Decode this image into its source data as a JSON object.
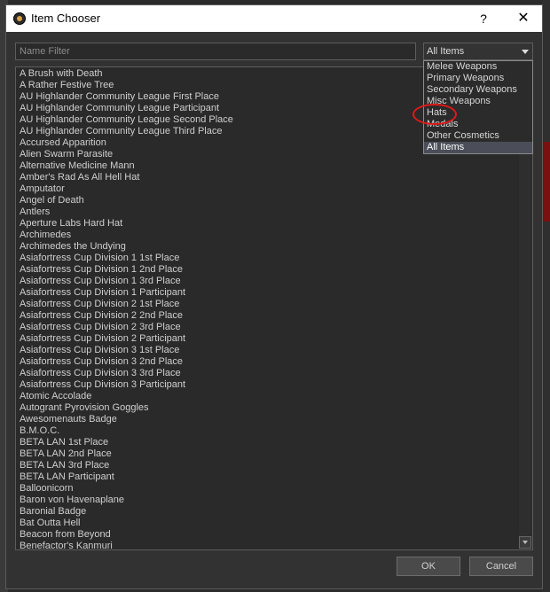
{
  "window": {
    "title": "Item Chooser",
    "help_label": "?",
    "close_label": "✕"
  },
  "filter": {
    "placeholder": "Name Filter",
    "value": ""
  },
  "category": {
    "selected": "All Items",
    "options": [
      "Melee Weapons",
      "Primary Weapons",
      "Secondary Weapons",
      "Misc Weapons",
      "Hats",
      "Medals",
      "Other Cosmetics",
      "All Items"
    ],
    "highlighted_option": "Hats",
    "highlight_color": "#e01919"
  },
  "items": [
    "A Brush with Death",
    "A Rather Festive Tree",
    "AU Highlander Community League First Place",
    "AU Highlander Community League Participant",
    "AU Highlander Community League Second Place",
    "AU Highlander Community League Third Place",
    "Accursed Apparition",
    "Alien Swarm Parasite",
    "Alternative Medicine Mann",
    "Amber's Rad As All Hell Hat",
    "Amputator",
    "Angel of Death",
    "Antlers",
    "Aperture Labs Hard Hat",
    "Archimedes",
    "Archimedes the Undying",
    "Asiafortress Cup Division 1 1st Place",
    "Asiafortress Cup Division 1 2nd Place",
    "Asiafortress Cup Division 1 3rd Place",
    "Asiafortress Cup Division 1 Participant",
    "Asiafortress Cup Division 2 1st Place",
    "Asiafortress Cup Division 2 2nd Place",
    "Asiafortress Cup Division 2 3rd Place",
    "Asiafortress Cup Division 2 Participant",
    "Asiafortress Cup Division 3 1st Place",
    "Asiafortress Cup Division 3 2nd Place",
    "Asiafortress Cup Division 3 3rd Place",
    "Asiafortress Cup Division 3 Participant",
    "Atomic Accolade",
    "Autogrant Pyrovision Goggles",
    "Awesomenauts Badge",
    "B.M.O.C.",
    "BETA LAN 1st Place",
    "BETA LAN 2nd Place",
    "BETA LAN 3rd Place",
    "BETA LAN Participant",
    "Balloonicorn",
    "Baron von Havenaplane",
    "Baronial Badge",
    "Bat Outta Hell",
    "Beacon from Beyond",
    "Benefactor's Kanmuri"
  ],
  "buttons": {
    "ok": "OK",
    "cancel": "Cancel"
  }
}
